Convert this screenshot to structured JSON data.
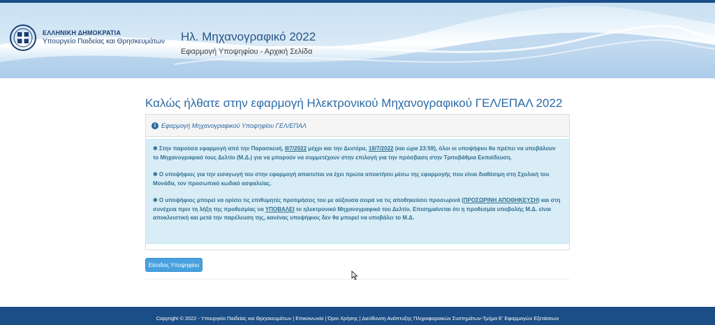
{
  "header": {
    "gov_line1": "ΕΛΛΗΝΙΚΗ ΔΗΜΟΚΡΑΤΙΑ",
    "gov_line2": "Υπουργείο Παιδείας και Θρησκευμάτων",
    "app_title": "Ηλ. Μηχανογραφικό 2022",
    "app_subtitle": "Εφαρμογή Υποψηφίου - Αρχική Σελίδα"
  },
  "main": {
    "welcome": "Καλώς ήλθατε στην εφαρμογή Ηλεκτρονικού Μηχανογραφικού ΓΕΛ/ΕΠΑΛ 2022",
    "panel_title": "Εφαρμογή Μηχανογραφικού Υποψηφίου ΓΕΛ/ΕΠΑΛ",
    "star": "✱",
    "p1": {
      "a": " Στην παρούσα εφαρμογή από την Παρασκευή, ",
      "d1": "8/7/2022",
      "b": " μέχρι και την Δευτέρα, ",
      "d2": "18/7/2022",
      "c": " (και ώρα 23:59), όλοι οι υποψήφιοι θα πρέπει να υποβάλουν το Μηχανογραφικό τους Δελτίο (Μ.Δ.) για να μπορούν να συμμετέχουν στην επιλογή για την πρόσβαση στην Τριτοβάθμια Εκπαίδευση."
    },
    "p2": " Ο υποψήφιος για την εισαγωγή του στην εφαρμογή απαιτείται να έχει πρώτα αποκτήσει μέσω της εφαρμογής που είναι διαθέσιμη στη Σχολική του Μονάδα, τον προσωπικό κωδικό ασφαλείας.",
    "p3": {
      "a": " Ο υποψήφιος μπορεί να ορίσει τις επιθυμητές προτιμήσεις του με αύξουσα σειρά να τις αποθηκεύσει προσωρινά (",
      "u1": "ΠΡΟΣΩΡΙΝΗ ΑΠΟΘΗΚΕΥΣΗ",
      "b": ") και στη συνέχεια πριν τη λήξη της προθεσμίας να ",
      "u2": "ΥΠΟΒΑΛΕΙ",
      "c": " το ηλεκτρονικό Μηχανογραφικό του Δελτίο. Επισημαίνεται ότι η προθεσμία υποβολής Μ.Δ. είναι αποκλειστική και μετά την παρέλευση της, κανένας υποψήφιος δεν θα μπορεί να υποβάλει το Μ.Δ."
    },
    "login_button": "Είσοδος Υποψηφίου"
  },
  "footer": {
    "text": "Copyright © 2022 - Υπουργείο Παιδείας και Θρησκευμάτων | Επικοινωνία | Όροι Χρήσης | Διεύθυνση Ανάπτυξης Πληροφοριακών Συστημάτων-Τμήμα Ε' Εφαρμογών Εξετάσεων"
  },
  "colors": {
    "brand_dark": "#1b4d86",
    "link_blue": "#2a6aa5",
    "alert_bg": "#d9edf7",
    "button": "#48a1df"
  }
}
